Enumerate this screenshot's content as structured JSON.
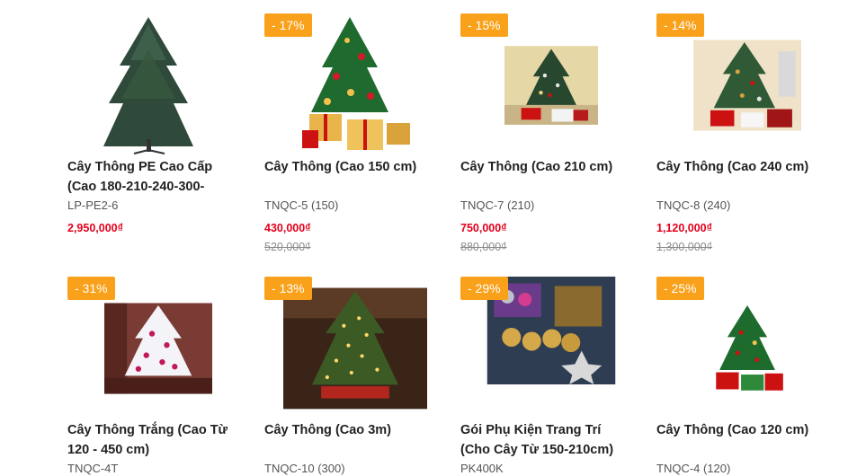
{
  "products": [
    {
      "name": "Cây Thông PE Cao Cấp (Cao 180-210-240-300-",
      "code": "LP-PE2-6",
      "price": "2,950,000₫",
      "old_price": "",
      "discount": "",
      "image": "dark-pine-tree-no-decor"
    },
    {
      "name": "Cây Thông (Cao 150 cm)",
      "code": "TNQC-5 (150)",
      "price": "430,000₫",
      "old_price": "520,000₫",
      "discount": "- 17%",
      "image": "decorated-tree-with-gifts"
    },
    {
      "name": "Cây Thông (Cao 210 cm)",
      "code": "TNQC-7 (210)",
      "price": "750,000₫",
      "old_price": "880,000₫",
      "discount": "- 15%",
      "image": "decorated-tree-room"
    },
    {
      "name": "Cây Thông (Cao 240 cm)",
      "code": "TNQC-8 (240)",
      "price": "1,120,000₫",
      "old_price": "1,300,000₫",
      "discount": "- 14%",
      "image": "decorated-tree-living-room"
    },
    {
      "name": "Cây Thông Trắng (Cao Từ 120 - 450 cm)",
      "code": "TNQC-4T",
      "price": "",
      "old_price": "",
      "discount": "- 31%",
      "image": "white-tree-pink-ornaments"
    },
    {
      "name": "Cây Thông (Cao 3m)",
      "code": "TNQC-10 (300)",
      "price": "",
      "old_price": "",
      "discount": "- 13%",
      "image": "lit-tree-lobby"
    },
    {
      "name": "Gói Phụ Kiện Trang Trí (Cho Cây Từ 150-210cm)",
      "code": "PK400K",
      "price": "",
      "old_price": "",
      "discount": "- 29%",
      "image": "ornament-accessory-pack"
    },
    {
      "name": "Cây Thông (Cao 120 cm)",
      "code": "TNQC-4 (120)",
      "price": "",
      "old_price": "",
      "discount": "- 25%",
      "image": "small-decorated-tree-gifts"
    }
  ],
  "colors": {
    "badge": "#f9a11b",
    "price": "#e3001b",
    "old_price": "#8a8a8a",
    "title": "#222222"
  }
}
